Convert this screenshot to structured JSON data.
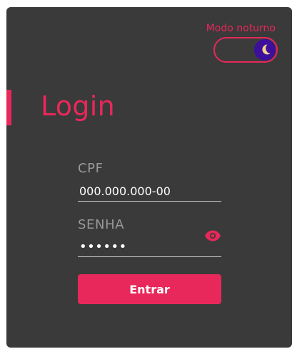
{
  "theme_toggle": {
    "label": "Modo noturno",
    "icon": "moon-icon",
    "enabled": true,
    "colors": {
      "accent": "#e8285a",
      "knob": "#3d0f9b",
      "moon": "#f6d28a"
    }
  },
  "login": {
    "title": "Login",
    "cpf": {
      "label": "CPF",
      "value": "000.000.000-00"
    },
    "password": {
      "label": "SENHA",
      "masked_value": "••••••",
      "visibility_icon": "eye-icon"
    },
    "submit_label": "Entrar"
  },
  "colors": {
    "card_background": "#3a3a3a",
    "accent": "#e8285a",
    "muted_text": "#999999",
    "input_text": "#ffffff"
  }
}
